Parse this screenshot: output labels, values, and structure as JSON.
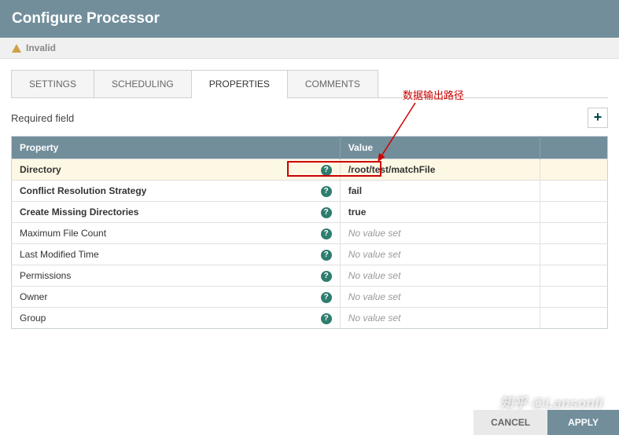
{
  "header": {
    "title": "Configure Processor"
  },
  "status": {
    "text": "Invalid"
  },
  "tabs": [
    {
      "label": "SETTINGS",
      "active": false
    },
    {
      "label": "SCHEDULING",
      "active": false
    },
    {
      "label": "PROPERTIES",
      "active": true
    },
    {
      "label": "COMMENTS",
      "active": false
    }
  ],
  "panel": {
    "required_label": "Required field"
  },
  "table": {
    "header_property": "Property",
    "header_value": "Value",
    "no_value_text": "No value set"
  },
  "properties": [
    {
      "name": "Directory",
      "bold": true,
      "value": "/root/test/matchFile",
      "highlight": true
    },
    {
      "name": "Conflict Resolution Strategy",
      "bold": true,
      "value": "fail"
    },
    {
      "name": "Create Missing Directories",
      "bold": true,
      "value": "true"
    },
    {
      "name": "Maximum File Count",
      "bold": false,
      "value": null
    },
    {
      "name": "Last Modified Time",
      "bold": false,
      "value": null
    },
    {
      "name": "Permissions",
      "bold": false,
      "value": null
    },
    {
      "name": "Owner",
      "bold": false,
      "value": null
    },
    {
      "name": "Group",
      "bold": false,
      "value": null
    }
  ],
  "annotation": {
    "text": "数据输出路径"
  },
  "watermark": {
    "text": "知乎 @Lansonli"
  },
  "footer": {
    "cancel": "CANCEL",
    "apply": "APPLY"
  }
}
